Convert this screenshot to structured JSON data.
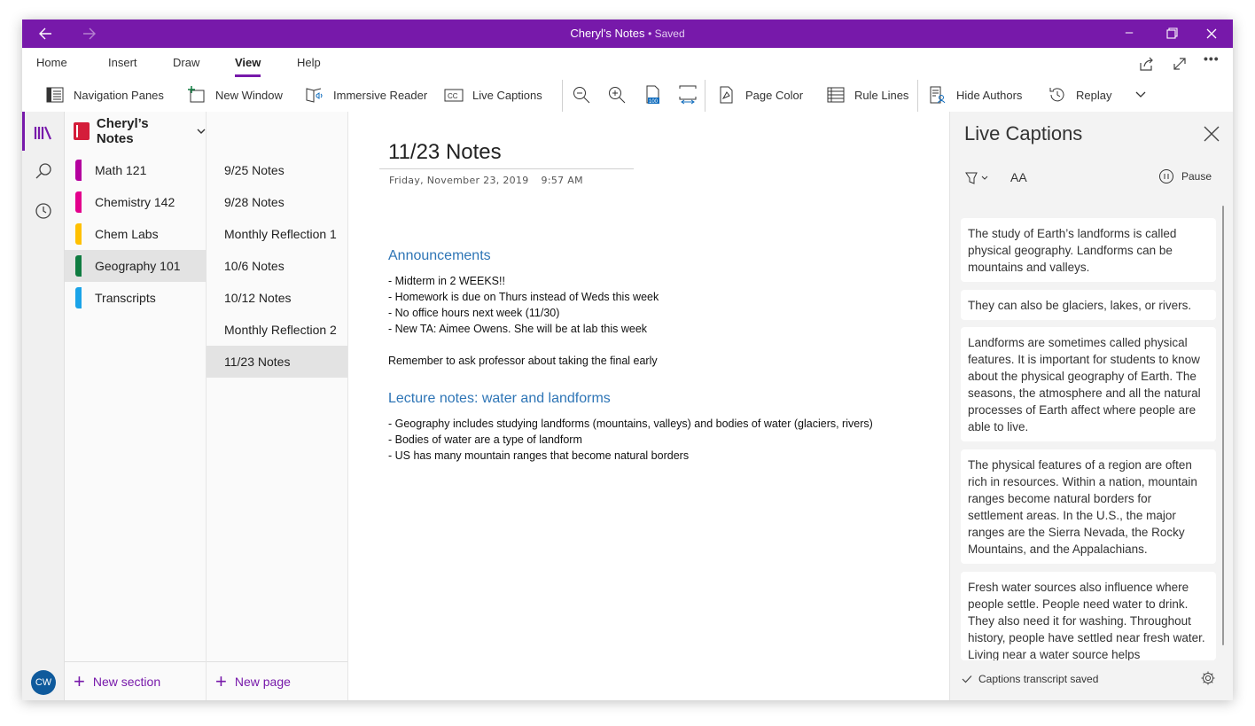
{
  "window": {
    "title": "Cheryl's Notes",
    "status": "Saved",
    "accent": "#7719aa"
  },
  "titlebar": {
    "back_icon": "arrow-left-icon",
    "forward_icon": "arrow-right-icon",
    "minimize": "–",
    "maximize": "□",
    "close": "✕"
  },
  "ribbon": {
    "tabs": [
      {
        "label": "Home",
        "active": false
      },
      {
        "label": "Insert",
        "active": false
      },
      {
        "label": "Draw",
        "active": false
      },
      {
        "label": "View",
        "active": true
      },
      {
        "label": "Help",
        "active": false
      }
    ],
    "right_icons": [
      "share-icon",
      "fullscreen-icon",
      "more-icon"
    ],
    "more": "•••"
  },
  "toolbar": {
    "navigation_panes": "Navigation Panes",
    "new_window": "New Window",
    "immersive_reader": "Immersive Reader",
    "live_captions": "Live Captions",
    "page_color": "Page Color",
    "rule_lines": "Rule Lines",
    "hide_authors": "Hide Authors",
    "replay": "Replay",
    "icons": [
      "zoom-out-icon",
      "zoom-in-icon",
      "zoom-100-icon",
      "page-width-icon"
    ]
  },
  "user": {
    "initials": "CW",
    "color": "#0f5a9c"
  },
  "notebook": {
    "name": "Cheryl’s Notes",
    "color": "#d41d3a",
    "sections": [
      {
        "label": "Math 121",
        "color": "#b4009e",
        "selected": false
      },
      {
        "label": "Chemistry 142",
        "color": "#e3008c",
        "selected": false
      },
      {
        "label": "Chem Labs",
        "color": "#ffc000",
        "selected": false
      },
      {
        "label": "Geography 101",
        "color": "#107c41",
        "selected": true
      },
      {
        "label": "Transcripts",
        "color": "#1aa3e8",
        "selected": false
      }
    ],
    "new_section": "New section"
  },
  "pages": {
    "items": [
      {
        "label": "9/25 Notes",
        "selected": false
      },
      {
        "label": "9/28 Notes",
        "selected": false
      },
      {
        "label": "Monthly Reflection 1",
        "selected": false
      },
      {
        "label": "10/6 Notes",
        "selected": false
      },
      {
        "label": "10/12 Notes",
        "selected": false
      },
      {
        "label": "Monthly Reflection 2",
        "selected": false
      },
      {
        "label": "11/23 Notes",
        "selected": true
      }
    ],
    "new_page": "New page"
  },
  "page": {
    "title": "11/23 Notes",
    "date": "Friday, November 23, 2019",
    "time": "9:57 AM",
    "heading1": "Announcements",
    "announcements": [
      "- Midterm in 2 WEEKS!!",
      "- Homework is due on Thurs instead of Weds this week",
      "- No office hours next week (11/30)",
      "- New TA: Aimee Owens. She will be at lab this week"
    ],
    "reminder": "Remember to ask professor about taking the final early",
    "heading2": "Lecture notes: water and landforms",
    "lecture": [
      "- Geography includes studying landforms (mountains, valleys) and bodies of water (glaciers, rivers)",
      "- Bodies of water are a type of landform",
      "- US has many mountain ranges that become natural borders"
    ]
  },
  "captions": {
    "title": "Live Captions",
    "text_size": "AA",
    "pause": "Pause",
    "cards": [
      "The study of Earth’s landforms is called physical geography. Landforms can be mountains and valleys.",
      "They can also be glaciers, lakes, or rivers.",
      "Landforms are sometimes called physical features. It is important for students to know about the physical geography of Earth. The seasons, the atmosphere and all the natural processes of Earth affect where people are able to live.",
      "The physical features of a region are often rich in resources. Within a nation, mountain ranges become natural borders for settlement areas. In the U.S., the major ranges are the Sierra Nevada, the Rocky Mountains, and the Appalachians.",
      "Fresh water sources also influence where people settle. People need water to drink. They also need it for washing. Throughout history, people have settled near fresh water. Living near a water source helps"
    ],
    "footer": "Captions transcript saved"
  }
}
